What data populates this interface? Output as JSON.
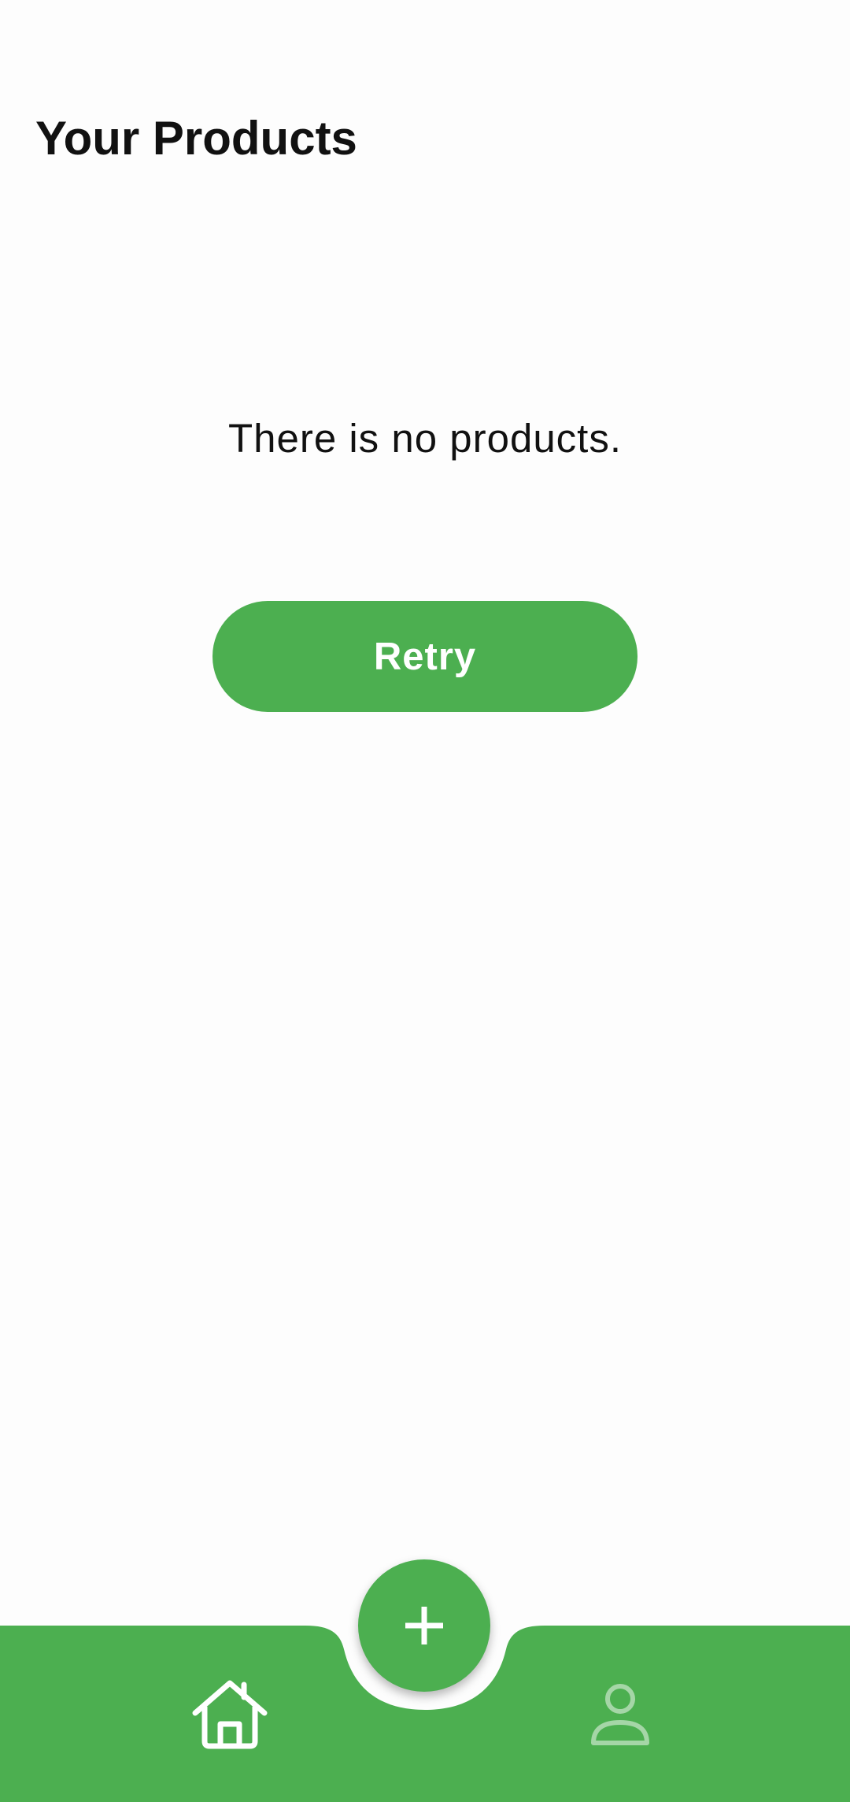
{
  "header": {
    "title": "Your Products"
  },
  "main": {
    "empty_message": "There is no products.",
    "retry_label": "Retry"
  },
  "bottom_nav": {
    "items": [
      {
        "icon": "home-icon",
        "active": true
      },
      {
        "icon": "person-icon",
        "active": false
      }
    ],
    "fab_icon": "plus-icon"
  },
  "colors": {
    "accent": "#4caf50",
    "background": "#fdfdfd",
    "text": "#111111",
    "inactive_icon": "#a5d6a7"
  }
}
